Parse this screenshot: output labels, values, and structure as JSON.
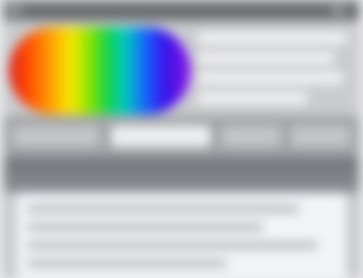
{
  "window": {
    "title": ""
  },
  "colors": {
    "logo_gradient": [
      "#e21a1a",
      "#ff4a00",
      "#ff9a00",
      "#f7e800",
      "#8ce600",
      "#15d34b",
      "#00c9c6",
      "#1a5cff",
      "#3b12e8",
      "#8a14e6"
    ],
    "titlebar": "#6a6d70",
    "toolbar": "#9ea1a4",
    "content_bg": "#f2f5f8"
  },
  "header": {
    "logo_name": "rainbow-logo",
    "lines": [
      "",
      "",
      "",
      ""
    ]
  },
  "toolbar": {
    "buttons": [
      "",
      "",
      "",
      ""
    ]
  },
  "content": {
    "rows": [
      "",
      "",
      "",
      ""
    ]
  }
}
